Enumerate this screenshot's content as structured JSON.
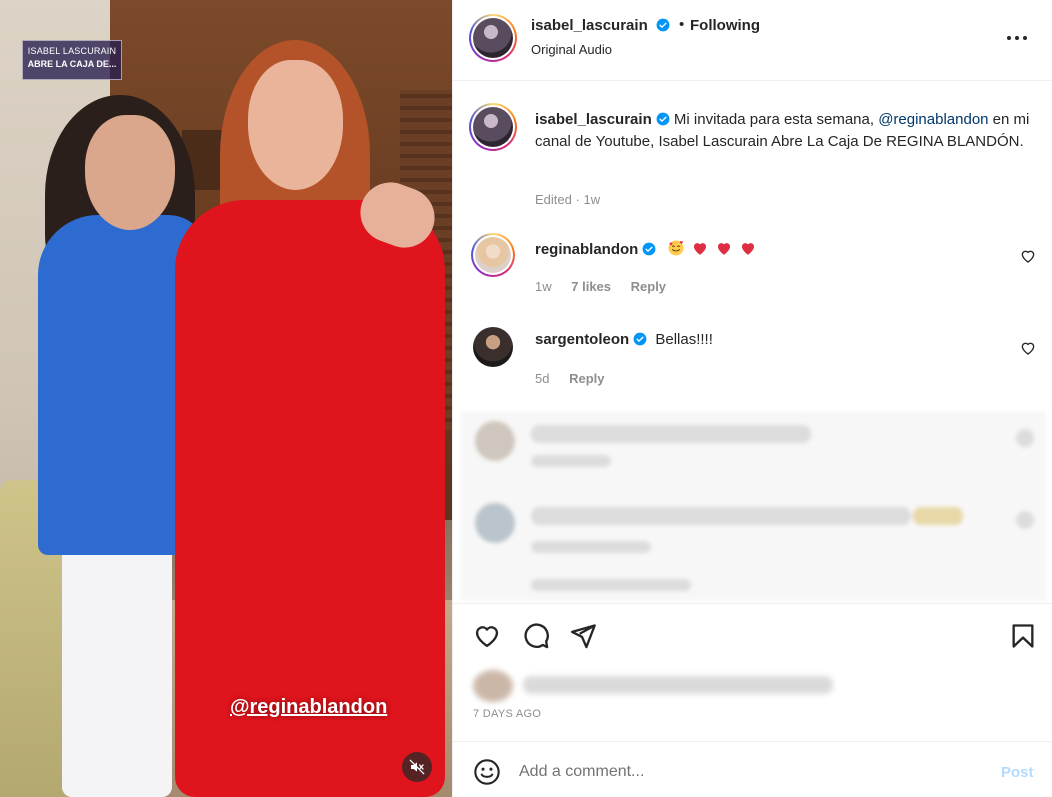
{
  "media": {
    "overlay_line1": "ISABEL LASCURAIN",
    "overlay_line2": "ABRE LA CAJA DE...",
    "mention_sticker": "@reginablandon",
    "mute_icon": "speaker-muted-icon"
  },
  "header": {
    "username": "isabel_lascurain",
    "separator": "•",
    "following_label": "Following",
    "audio_label": "Original Audio",
    "more_icon": "more-horizontal-icon"
  },
  "caption": {
    "username": "isabel_lascurain",
    "text_before_mention": " Mi invitada para esta semana, ",
    "mention": "@reginablandon",
    "text_after_mention": " en mi canal de Youtube, Isabel Lascurain Abre La Caja De REGINA BLANDÓN.",
    "edited_label": "Edited",
    "meta_separator": "·",
    "time": "1w"
  },
  "comments": [
    {
      "username": "reginablandon",
      "text": "",
      "emojis": [
        "smiling-face-with-hearts",
        "red-heart",
        "red-heart",
        "red-heart"
      ],
      "time": "1w",
      "likes": "7 likes",
      "reply_label": "Reply"
    },
    {
      "username": "sargentoleon",
      "text": "Bellas!!!!",
      "time": "5d",
      "reply_label": "Reply"
    }
  ],
  "actions": {
    "like_icon": "heart-icon",
    "comment_icon": "comment-icon",
    "share_icon": "paper-plane-icon",
    "save_icon": "bookmark-icon"
  },
  "post_time": "7 DAYS AGO",
  "comment_bar": {
    "emoji_icon": "smiley-icon",
    "placeholder": "Add a comment...",
    "post_label": "Post"
  },
  "colors": {
    "verified": "#0095f6",
    "link": "#00376b",
    "post_disabled": "#b3dbff",
    "heart_red": "#ff3040"
  }
}
